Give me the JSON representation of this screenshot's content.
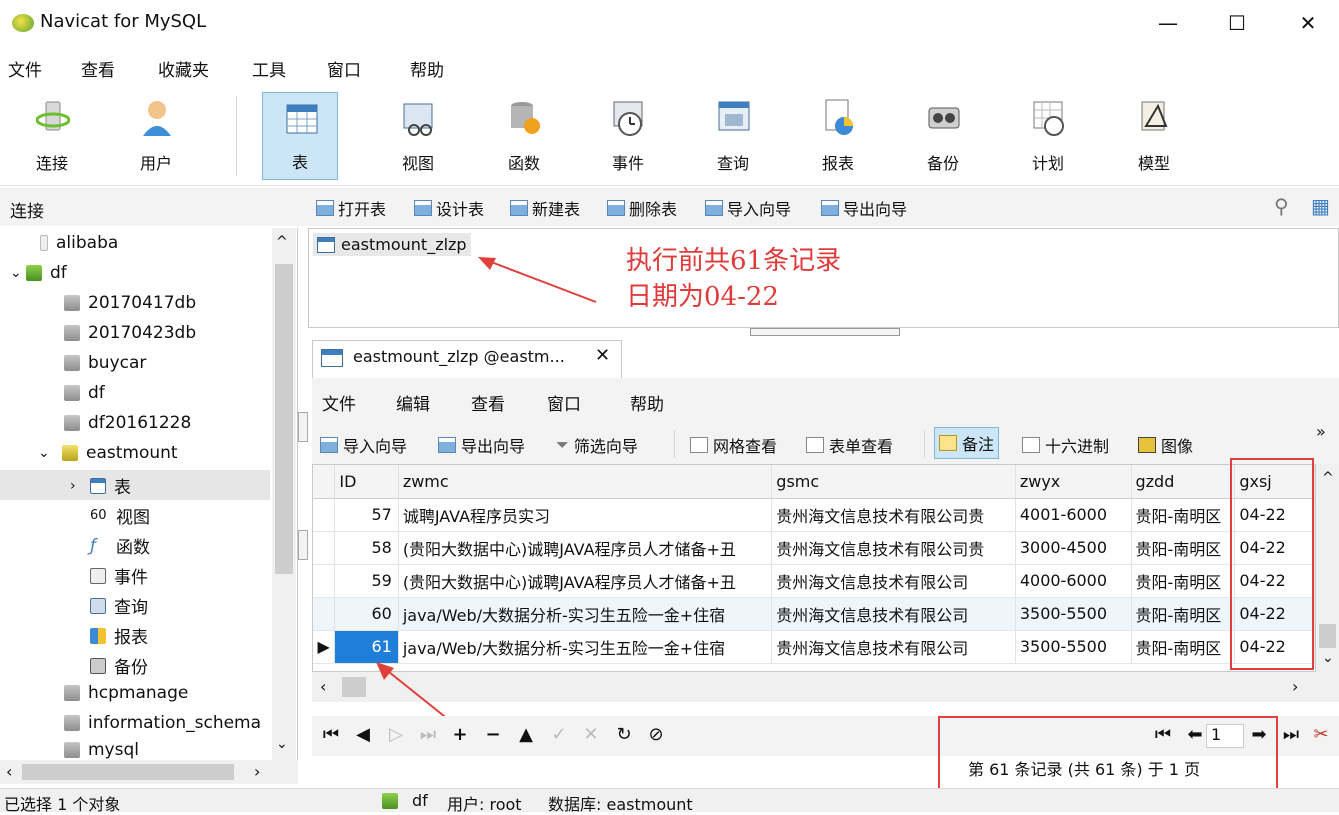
{
  "window": {
    "title": "Navicat for MySQL",
    "minimize": "—",
    "maximize": "☐",
    "close": "✕"
  },
  "menu": [
    "文件",
    "查看",
    "收藏夹",
    "工具",
    "窗口",
    "帮助"
  ],
  "toolbar": {
    "items": [
      {
        "label": "连接",
        "icon": "connect-icon"
      },
      {
        "label": "用户",
        "icon": "user-icon"
      },
      {
        "label": "表",
        "icon": "table-icon",
        "active": true
      },
      {
        "label": "视图",
        "icon": "view-icon"
      },
      {
        "label": "函数",
        "icon": "function-icon"
      },
      {
        "label": "事件",
        "icon": "event-icon"
      },
      {
        "label": "查询",
        "icon": "query-icon"
      },
      {
        "label": "报表",
        "icon": "report-icon"
      },
      {
        "label": "备份",
        "icon": "backup-icon"
      },
      {
        "label": "计划",
        "icon": "schedule-icon"
      },
      {
        "label": "模型",
        "icon": "model-icon"
      }
    ]
  },
  "connections": {
    "header": "连接",
    "tree": [
      {
        "label": "alibaba"
      },
      {
        "label": "df"
      },
      {
        "label": "20170417db"
      },
      {
        "label": "20170423db"
      },
      {
        "label": "buycar"
      },
      {
        "label": "df"
      },
      {
        "label": "df20161228"
      },
      {
        "label": "eastmount"
      },
      {
        "label": "表"
      },
      {
        "label": "视图"
      },
      {
        "label": "函数"
      },
      {
        "label": "事件"
      },
      {
        "label": "查询"
      },
      {
        "label": "报表"
      },
      {
        "label": "备份"
      },
      {
        "label": "hcpmanage"
      },
      {
        "label": "information_schema"
      },
      {
        "label": "mysql"
      }
    ]
  },
  "object_toolbar": [
    "打开表",
    "设计表",
    "新建表",
    "删除表",
    "导入向导",
    "导出向导"
  ],
  "object_list": [
    "eastmount_zlzp"
  ],
  "annotation": {
    "line1": "执行前共61条记录",
    "line2": "日期为04-22"
  },
  "tab": {
    "title": "eastmount_zlzp @eastm...",
    "close": "✕"
  },
  "sub_menu": [
    "文件",
    "编辑",
    "查看",
    "窗口",
    "帮助"
  ],
  "grid_toolbar": [
    "导入向导",
    "导出向导",
    "筛选向导",
    "网格查看",
    "表单查看",
    "备注",
    "十六进制",
    "图像"
  ],
  "grid": {
    "columns": [
      "ID",
      "zwmc",
      "gsmc",
      "zwyx",
      "gzdd",
      "gxsj"
    ],
    "rows": [
      [
        "57",
        "诚聘JAVA程序员实习",
        "贵州海文信息技术有限公司贵",
        "4001-6000",
        "贵阳-南明区",
        "04-22"
      ],
      [
        "58",
        "(贵阳大数据中心)诚聘JAVA程序员人才储备+丑",
        "贵州海文信息技术有限公司贵",
        "3000-4500",
        "贵阳-南明区",
        "04-22"
      ],
      [
        "59",
        "(贵阳大数据中心)诚聘JAVA程序员人才储备+丑",
        "贵州海文信息技术有限公司",
        "4000-6000",
        "贵阳-南明区",
        "04-22"
      ],
      [
        "60",
        "java/Web/大数据分析-实习生五险一金+住宿",
        "贵州海文信息技术有限公司",
        "3500-5500",
        "贵阳-南明区",
        "04-22"
      ],
      [
        "61",
        "java/Web/大数据分析-实习生五险一金+住宿",
        "贵州海文信息技术有限公司",
        "3500-5500",
        "贵阳-南明区",
        "04-22"
      ]
    ]
  },
  "pager": {
    "page": "1",
    "record_info": "第 61 条记录 (共 61 条) 于 1 页"
  },
  "status": {
    "selection": "已选择 1 个对象",
    "connection": "df",
    "user": "用户: root",
    "database": "数据库: eastmount"
  }
}
